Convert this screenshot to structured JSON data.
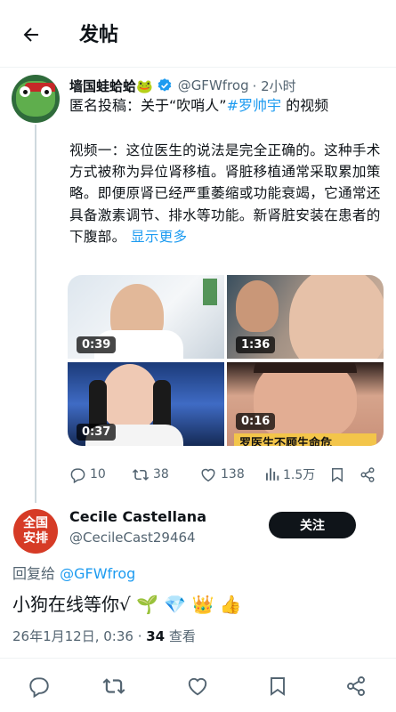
{
  "header": {
    "title": "发帖"
  },
  "post": {
    "author_name": "墙国蛙蛤蛤🐸",
    "handle": "@GFWfrog",
    "time": "· 2小时",
    "intro_prefix": "匿名投稿：关于“吹哨人”",
    "hashtag": "#罗帅宇",
    "intro_suffix": " 的视频",
    "body": "视频一：这位医生的说法是完全正确的。这种手术方式被称为异位肾移植。肾脏移植通常采取累加策略。即便原肾已经严重萎缩或功能衰竭，它通常还具备激素调节、排水等功能。新肾脏安装在患者的下腹部。",
    "show_more": "显示更多",
    "media": [
      {
        "duration": "0:39"
      },
      {
        "duration": "1:36"
      },
      {
        "duration": "0:37"
      },
      {
        "duration": "0:16",
        "caption": "罗医生不顾生命危"
      }
    ],
    "stats": {
      "replies": "10",
      "reposts": "38",
      "likes": "138",
      "views": "1.5万"
    }
  },
  "reply": {
    "avatar_text_line1": "全国",
    "avatar_text_line2": "安排",
    "author_name": "Cecile Castellana",
    "handle": "@CecileCast29464",
    "follow_label": "关注",
    "replying_prefix": "回复给 ",
    "replying_to": "@GFWfrog",
    "text": "小狗在线等你√ 🌱 💎 👑 👍",
    "timestamp": "26年1月12日, 0:36 · ",
    "views_count": "34",
    "views_label": " 查看"
  },
  "colors": {
    "accent": "#1d9bf0",
    "text": "#0f1419",
    "secondary": "#536471",
    "follow_bg": "#0f1419"
  }
}
